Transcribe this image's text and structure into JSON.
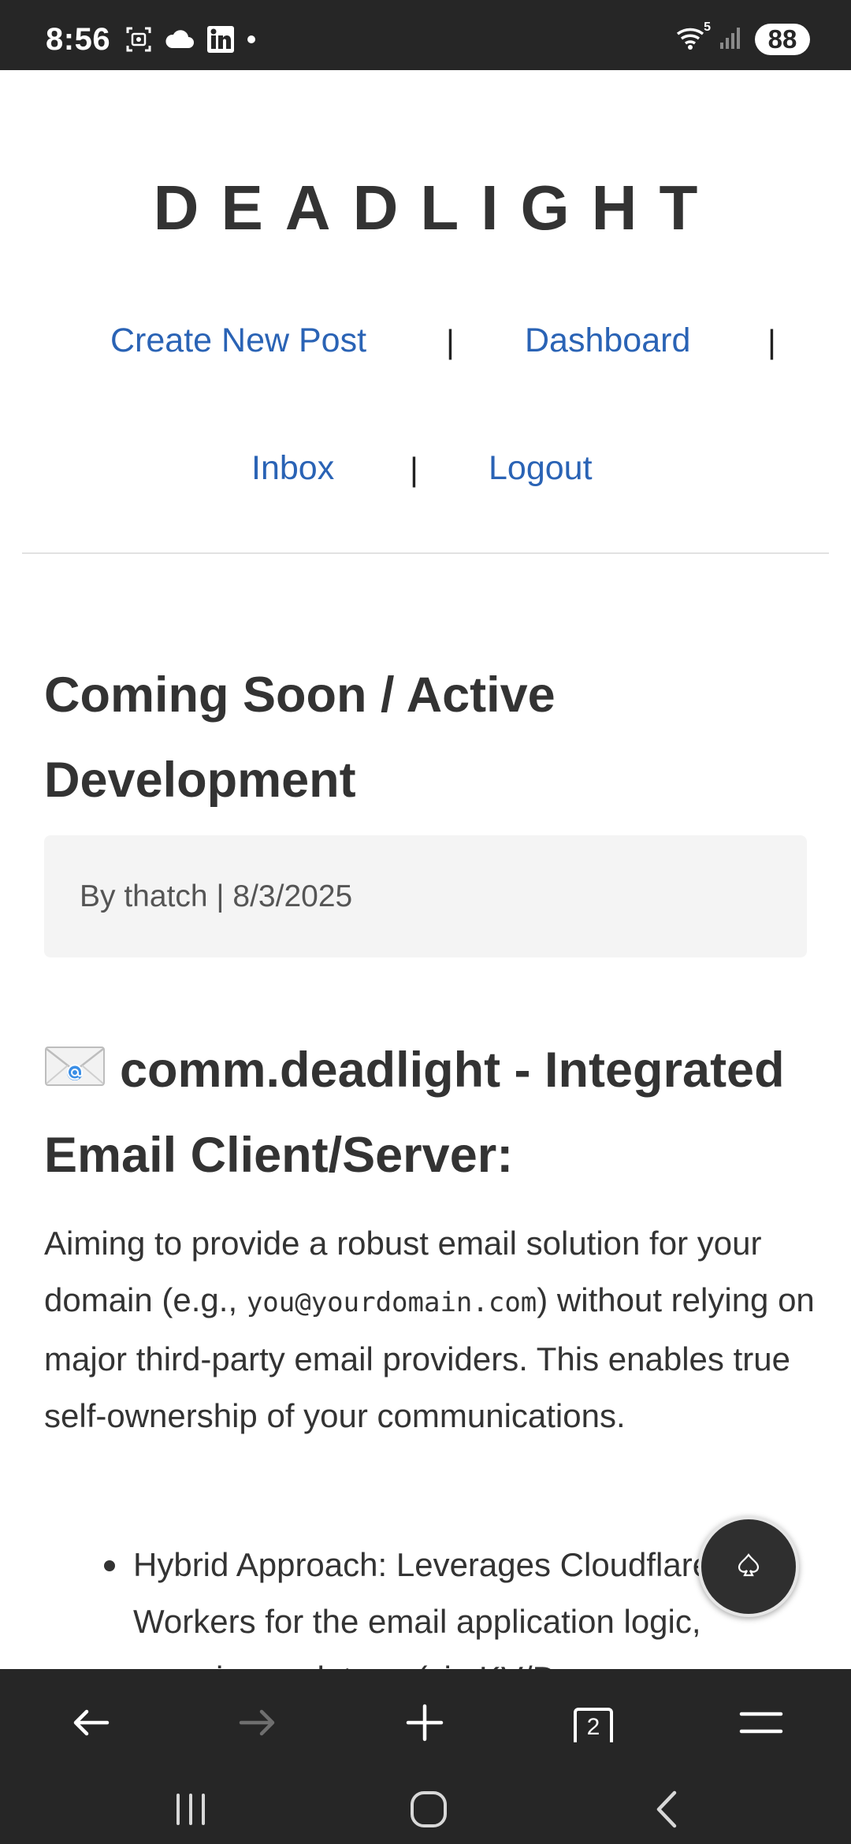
{
  "status_bar": {
    "time": "8:56",
    "battery": "88",
    "left_icons": [
      "screenshot-icon",
      "cloud-icon",
      "linkedin-icon",
      "notification-dot-icon"
    ],
    "right_icons": [
      "wifi-icon",
      "signal-icon",
      "battery-icon"
    ],
    "wifi_label": "5"
  },
  "site": {
    "title": "DEADLIGHT"
  },
  "nav": {
    "create_new_post": "Create New Post",
    "dashboard": "Dashboard",
    "inbox": "Inbox",
    "logout": "Logout",
    "separator": "|"
  },
  "post": {
    "title": "Coming Soon / Active Development",
    "byline": "By thatch | 8/3/2025",
    "section_heading": "comm.deadlight - Integrated Email Client/Server:",
    "section_icon": "envelope-icon",
    "paragraph": {
      "before_code": "Aiming to provide a robust email solution for your domain (e.g., ",
      "code": "you@yourdomain.com",
      "after_code": ") without relying on major third-party email providers. This enables true self-ownership of your communications."
    },
    "bullets": [
      "Hybrid Approach: Leverages Cloudflare Workers for the email application logic, ensuring ... data ... (via KV/D..."
    ]
  },
  "fab": {
    "icon": "spade-icon"
  },
  "browser_toolbar": {
    "back_icon": "arrow-left-icon",
    "forward_icon": "arrow-right-icon",
    "new_tab_icon": "plus-icon",
    "tabs_count": "2",
    "menu_icon": "menu-icon"
  },
  "system_nav": {
    "icons": [
      "recents-icon",
      "home-icon",
      "back-icon"
    ]
  },
  "colors": {
    "link": "#2a63b5",
    "text": "#333333",
    "bar_bg": "#262626"
  }
}
